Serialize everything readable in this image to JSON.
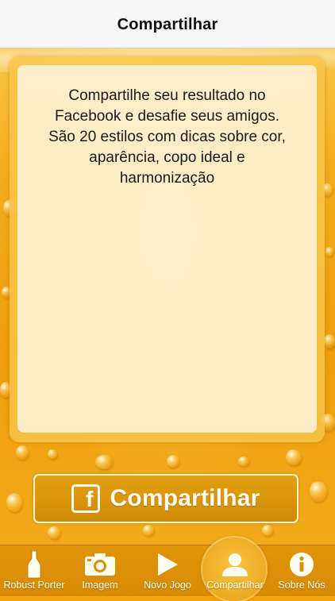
{
  "navbar": {
    "title": "Compartilhar"
  },
  "panel": {
    "lines": [
      "Compartilhe seu resultado no",
      "Facebook e desafie seus amigos.",
      "São 20 estilos com dicas sobre cor,",
      "aparência, copo ideal e",
      "harmonização"
    ]
  },
  "share_button": {
    "icon_letter": "f",
    "label": "Compartilhar",
    "icon": "facebook-icon"
  },
  "tabbar": {
    "selected": "Compartilhar",
    "tabs": [
      {
        "label": "Robust Porter",
        "icon": "bottle-icon"
      },
      {
        "label": "Imagem",
        "icon": "camera-icon"
      },
      {
        "label": "Novo Jogo",
        "icon": "play-icon"
      },
      {
        "label": "Compartilhar",
        "icon": "person-icon"
      },
      {
        "label": "Sobre Nós",
        "icon": "info-icon"
      }
    ]
  },
  "colors": {
    "beer": "#f2a411",
    "tabbar": "#dc8f08",
    "panel": "#fdf0d2",
    "text_light": "#fffdf3"
  }
}
